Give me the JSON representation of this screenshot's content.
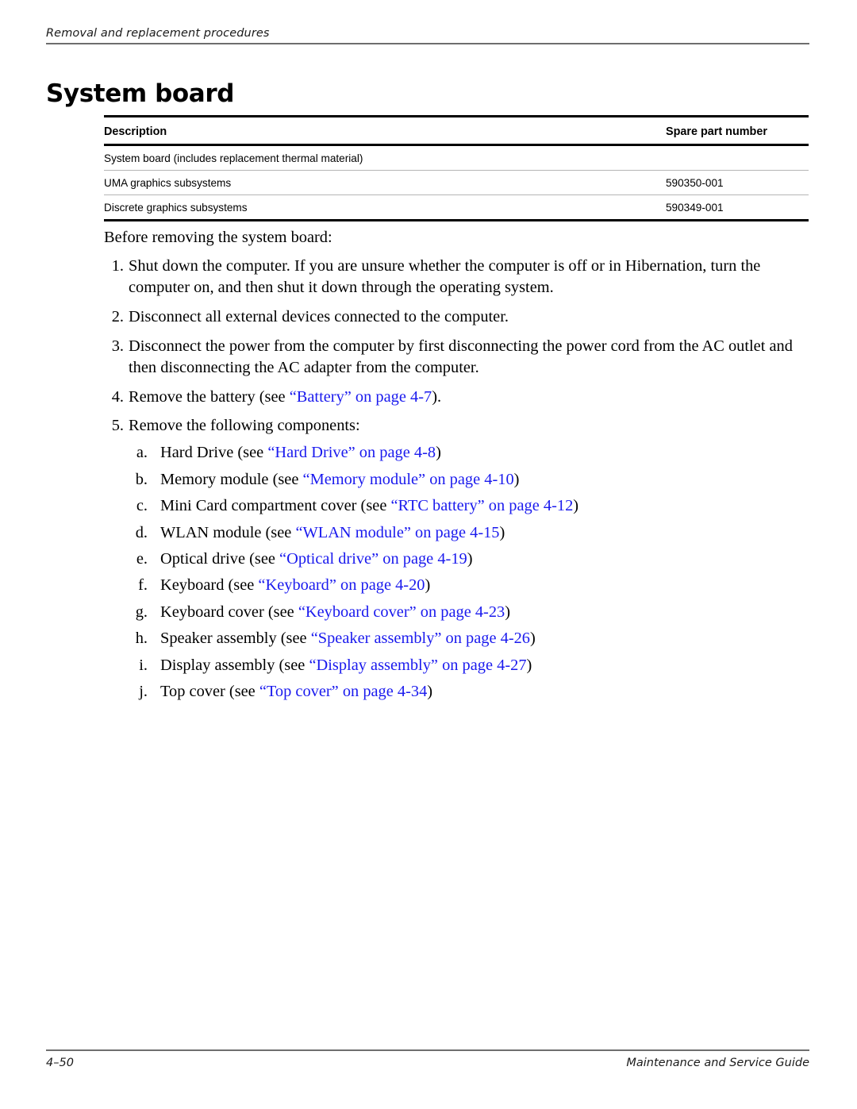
{
  "running_header": {
    "text": "Removal and replacement procedures"
  },
  "page_title": "System board",
  "parts_table": {
    "columns": [
      "Description",
      "Spare part number"
    ],
    "rows": [
      {
        "description": "System board (includes replacement thermal material)",
        "part_number": "",
        "indent": 0
      },
      {
        "description": "UMA graphics subsystems",
        "part_number": "590350-001",
        "indent": 1
      },
      {
        "description": "Discrete graphics subsystems",
        "part_number": "590349-001",
        "indent": 1
      }
    ]
  },
  "body": {
    "intro": "Before removing the system board:",
    "steps": [
      {
        "marker": "1.",
        "text": "Shut down the computer. If you are unsure whether the computer is off or in Hibernation, turn the computer on, and then shut it down through the operating system."
      },
      {
        "marker": "2.",
        "text": "Disconnect all external devices connected to the computer."
      },
      {
        "marker": "3.",
        "text": "Disconnect the power from the computer by first disconnecting the power cord from the AC outlet and then disconnecting the AC adapter from the computer."
      },
      {
        "marker": "4.",
        "prefix": "Remove the battery (see ",
        "link": "“Battery” on page 4-7",
        "suffix": ")."
      },
      {
        "marker": "5.",
        "text": "Remove the following components:",
        "substeps": [
          {
            "marker": "a.",
            "prefix": "Hard Drive (see ",
            "link": "“Hard Drive” on page 4-8",
            "suffix": ")"
          },
          {
            "marker": "b.",
            "prefix": "Memory module (see ",
            "link": "“Memory module” on page 4-10",
            "suffix": ")"
          },
          {
            "marker": "c.",
            "prefix": "Mini Card compartment cover (see ",
            "link": "“RTC battery” on page 4-12",
            "suffix": ")"
          },
          {
            "marker": "d.",
            "prefix": "WLAN module (see ",
            "link": "“WLAN module” on page 4-15",
            "suffix": ")"
          },
          {
            "marker": "e.",
            "prefix": "Optical drive (see ",
            "link": "“Optical drive” on page 4-19",
            "suffix": ")"
          },
          {
            "marker": "f.",
            "prefix": "Keyboard (see ",
            "link": "“Keyboard” on page 4-20",
            "suffix": ")"
          },
          {
            "marker": "g.",
            "prefix": "Keyboard cover (see ",
            "link": "“Keyboard cover” on page 4-23",
            "suffix": ")"
          },
          {
            "marker": "h.",
            "prefix": "Speaker assembly (see ",
            "link": "“Speaker assembly” on page 4-26",
            "suffix": ")"
          },
          {
            "marker": "i.",
            "prefix": "Display assembly (see ",
            "link": "“Display assembly” on page 4-27",
            "suffix": ")"
          },
          {
            "marker": "j.",
            "prefix": "Top cover (see ",
            "link": "“Top cover” on page 4-34",
            "suffix": ")"
          }
        ]
      }
    ]
  },
  "footer": {
    "page_number": "4–50",
    "guide_title": "Maintenance and Service Guide"
  },
  "colors": {
    "cross_reference_link": "#1a1aee",
    "rule": "#6e6e6e",
    "table_rule_heavy": "#000000",
    "table_rule_light": "#b5b5b5"
  }
}
